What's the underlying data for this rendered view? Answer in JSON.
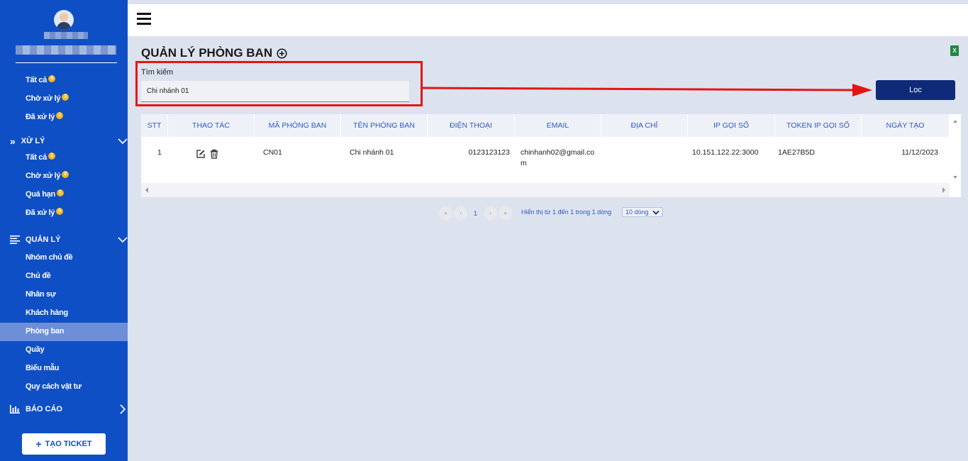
{
  "sidebar": {
    "filter_items": [
      {
        "label": "Tất cả",
        "badge": "4"
      },
      {
        "label": "Chờ xử lý",
        "badge": "3"
      },
      {
        "label": "Đã xử lý",
        "badge": "1"
      }
    ],
    "xu_ly": {
      "title": "XỬ LÝ",
      "items": [
        {
          "label": "Tất cả",
          "badge": "1"
        },
        {
          "label": "Chờ xử lý",
          "badge": "0"
        },
        {
          "label": "Quá hạn",
          "badge": "1"
        },
        {
          "label": "Đã xử lý",
          "badge": "0"
        }
      ]
    },
    "quan_ly": {
      "title": "QUẢN LÝ",
      "items": [
        "Nhóm chủ đề",
        "Chủ đề",
        "Nhân sự",
        "Khách hàng",
        "Phòng ban",
        "Quầy",
        "Biểu mẫu",
        "Quy cách vật tư"
      ],
      "active": "Phòng ban"
    },
    "bao_cao": {
      "title": "BÁO CÁO"
    },
    "create_ticket": "TẠO TICKET"
  },
  "page": {
    "title": "QUẢN LÝ PHÒNG BAN",
    "search_label": "Tìm kiếm",
    "search_value": "Chi nhánh 01",
    "filter_button": "Lọc"
  },
  "table": {
    "headers": [
      "STT",
      "THAO TÁC",
      "MÃ PHÒNG BAN",
      "TÊN PHÒNG BAN",
      "ĐIỆN THOẠI",
      "EMAIL",
      "ĐỊA CHỈ",
      "IP GỌI SỐ",
      "TOKEN IP GỌI SỐ",
      "NGÀY TẠO"
    ],
    "rows": [
      {
        "stt": "1",
        "ma": "CN01",
        "ten": "Chi nhánh 01",
        "dien_thoai": "0123123123",
        "email_line1": "chinhanh02@gmail.co",
        "email_line2": "m",
        "dia_chi": "",
        "ip": "10.151.122.22:3000",
        "token": "1AE27B5D",
        "ngay_tao": "11/12/2023"
      }
    ]
  },
  "pagination": {
    "current_page": "1",
    "info": "Hiển thị từ 1 đến 1 trong 1 dòng",
    "page_size": "10 dòng"
  },
  "colors": {
    "sidebar": "#0f4fc6",
    "accent_button": "#0e2a78",
    "highlight_box": "#e31616",
    "badge": "#f5b81c"
  }
}
